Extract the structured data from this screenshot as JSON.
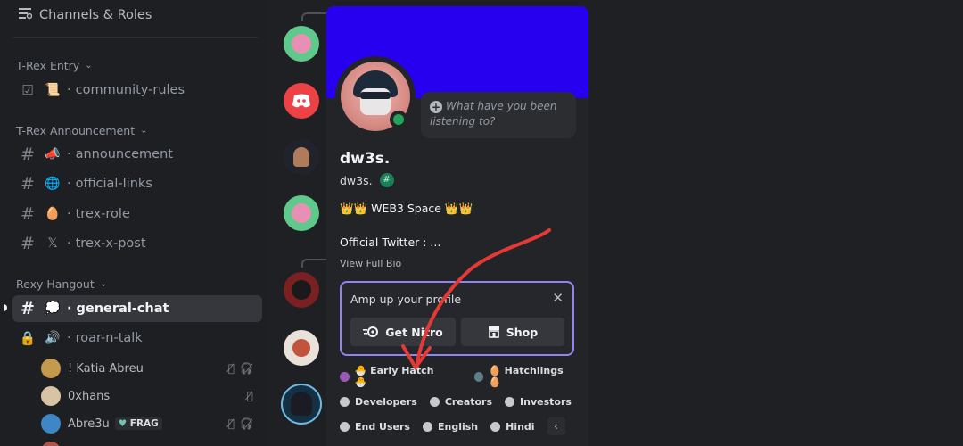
{
  "sidebar": {
    "header": "Channels & Roles",
    "categories": [
      {
        "label": "T-Rex Entry"
      },
      {
        "label": "T-Rex Announcement"
      },
      {
        "label": "Rexy Hangout"
      }
    ],
    "channels": [
      {
        "emoji": "📜",
        "name": "community-rules"
      },
      {
        "emoji": "📣",
        "name": "announcement"
      },
      {
        "emoji": "🌐",
        "name": "official-links"
      },
      {
        "emoji": "🥚",
        "name": "trex-role"
      },
      {
        "emoji": "𝕏",
        "name": "trex-x-post"
      },
      {
        "emoji": "💭",
        "name": "general-chat"
      },
      {
        "emoji": "🔊",
        "name": "roar-n-talk"
      }
    ],
    "voice_users": [
      {
        "name": "! Katia Abreu",
        "tag": ""
      },
      {
        "name": "0xhans",
        "tag": ""
      },
      {
        "name": "Abre3u",
        "tag": "FRAG"
      }
    ]
  },
  "profile": {
    "display_name": "dw3s.",
    "username": "dw3s.",
    "listening_placeholder": "What have you been listening to?",
    "custom_status": "👑👑 WEB3 Space 👑👑",
    "bio": "Official Twitter : ...",
    "view_full_bio": "View Full Bio",
    "nitro": {
      "title": "Amp up your profile",
      "get_nitro": "Get Nitro",
      "shop": "Shop"
    },
    "roles": [
      {
        "label": "🐣 Early Hatch 🐣",
        "color": "#9b59b6"
      },
      {
        "label": "🥚 Hatchlings 🥚",
        "color": "#607d8b"
      },
      {
        "label": "Developers",
        "color": "#c8c9cc"
      },
      {
        "label": "Creators",
        "color": "#c8c9cc"
      },
      {
        "label": "Investors",
        "color": "#c8c9cc"
      },
      {
        "label": "End Users",
        "color": "#c8c9cc"
      },
      {
        "label": "English",
        "color": "#c8c9cc"
      },
      {
        "label": "Hindi",
        "color": "#c8c9cc"
      }
    ]
  },
  "colors": {
    "banner": "#2800f0",
    "nitro_border": "#8f85f0",
    "annotation_arrow": "#e53935",
    "online": "#23a559"
  }
}
